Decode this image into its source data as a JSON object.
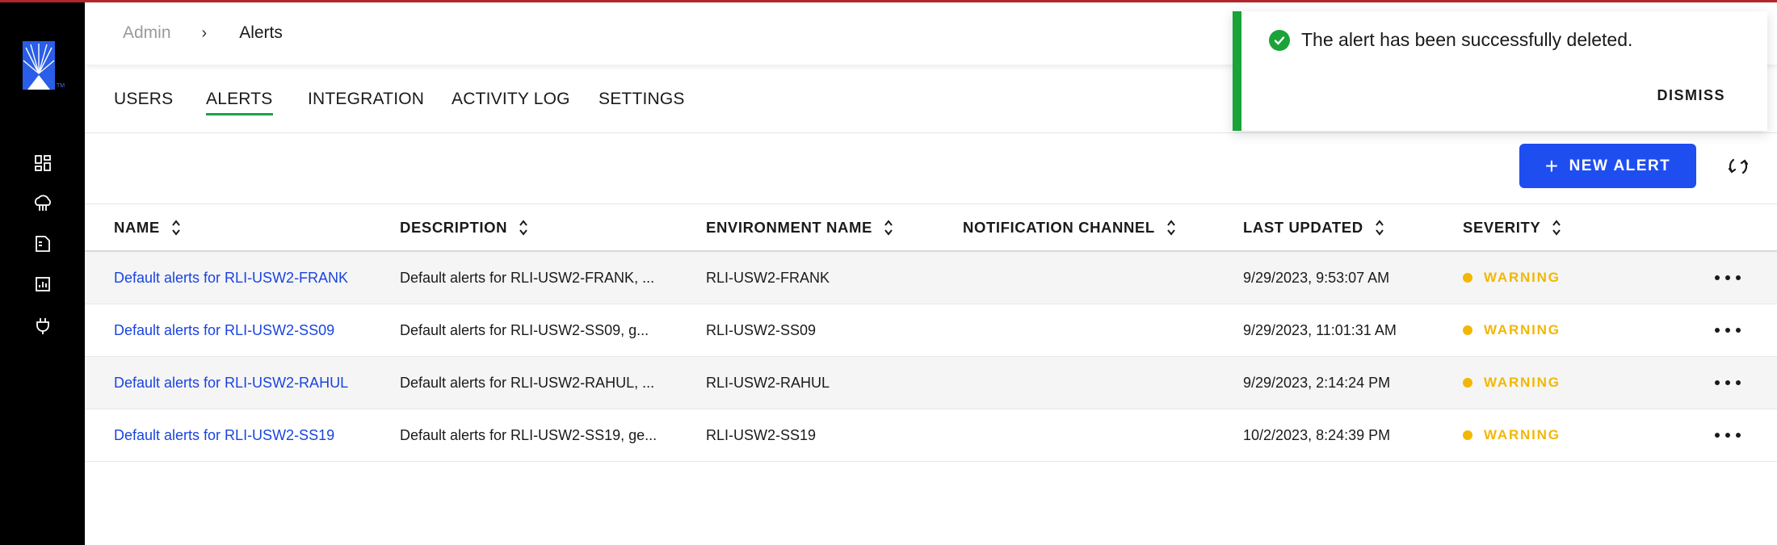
{
  "breadcrumb": {
    "parent": "Admin",
    "separator": "›",
    "current": "Alerts"
  },
  "tabs": [
    {
      "label": "USERS",
      "active": false
    },
    {
      "label": "ALERTS",
      "active": true
    },
    {
      "label": "INTEGRATION",
      "active": false
    },
    {
      "label": "ACTIVITY LOG",
      "active": false
    },
    {
      "label": "SETTINGS",
      "active": false
    }
  ],
  "sidebar": {
    "logo_mark": "TM",
    "items": [
      {
        "icon": "dashboard-icon"
      },
      {
        "icon": "cloud-icon"
      },
      {
        "icon": "document-icon"
      },
      {
        "icon": "chart-icon"
      },
      {
        "icon": "plug-icon"
      }
    ]
  },
  "toolbar": {
    "new_alert_label": "NEW ALERT",
    "new_alert_icon": "+",
    "refresh_icon": "refresh-icon"
  },
  "table": {
    "columns": [
      "NAME",
      "DESCRIPTION",
      "ENVIRONMENT NAME",
      "NOTIFICATION CHANNEL",
      "LAST UPDATED",
      "SEVERITY"
    ],
    "rows": [
      {
        "name": "Default alerts for RLI-USW2-FRANK",
        "description": "Default alerts for RLI-USW2-FRANK, ...",
        "environment": "RLI-USW2-FRANK",
        "channel": "",
        "updated": "9/29/2023, 9:53:07 AM",
        "severity": "WARNING"
      },
      {
        "name": "Default alerts for RLI-USW2-SS09",
        "description": "Default alerts for RLI-USW2-SS09, g...",
        "environment": "RLI-USW2-SS09",
        "channel": "",
        "updated": "9/29/2023, 11:01:31 AM",
        "severity": "WARNING"
      },
      {
        "name": "Default alerts for RLI-USW2-RAHUL",
        "description": "Default alerts for RLI-USW2-RAHUL, ...",
        "environment": "RLI-USW2-RAHUL",
        "channel": "",
        "updated": "9/29/2023, 2:14:24 PM",
        "severity": "WARNING"
      },
      {
        "name": "Default alerts for RLI-USW2-SS19",
        "description": "Default alerts for RLI-USW2-SS19, ge...",
        "environment": "RLI-USW2-SS19",
        "channel": "",
        "updated": "10/2/2023, 8:24:39 PM",
        "severity": "WARNING"
      }
    ]
  },
  "toast": {
    "message": "The alert has been successfully deleted.",
    "dismiss_label": "DISMISS"
  },
  "colors": {
    "accent": "#1f4ef0",
    "link": "#1a44e0",
    "success": "#19a338",
    "warning": "#f2b705",
    "sidebar": "#000000",
    "top_line": "#b3262e"
  }
}
